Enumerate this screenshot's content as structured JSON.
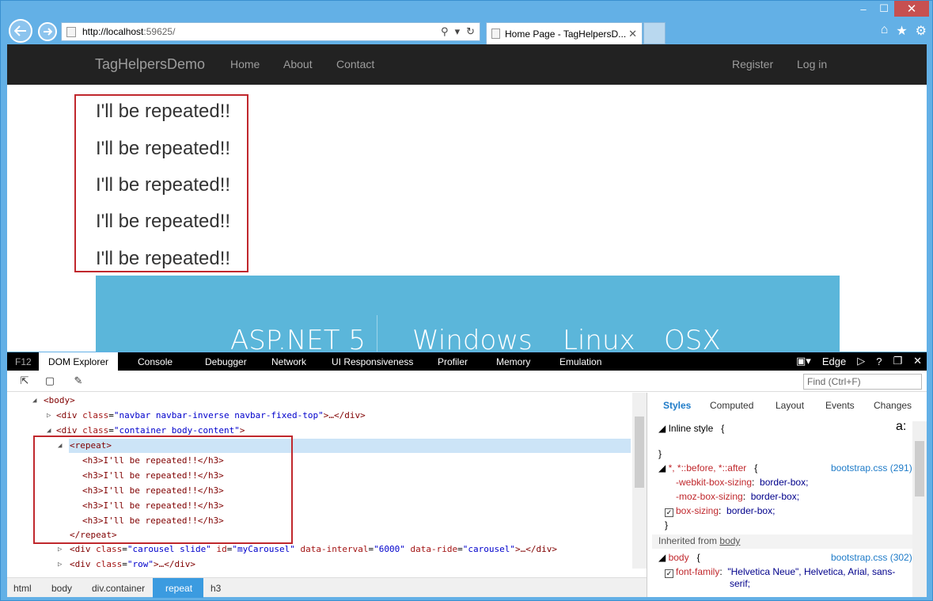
{
  "browser": {
    "address": {
      "host": "http://localhost",
      "rest": ":59625/"
    },
    "tab_title": "Home Page - TagHelpersD...",
    "window_buttons": [
      "–",
      "☐",
      "✕"
    ],
    "icons": [
      "home-icon",
      "star-icon",
      "gear-icon"
    ]
  },
  "site": {
    "brand": "TagHelpersDemo",
    "nav": [
      "Home",
      "About",
      "Contact"
    ],
    "nav_right": [
      "Register",
      "Log in"
    ],
    "repeated": [
      "I'll be repeated!!",
      "I'll be repeated!!",
      "I'll be repeated!!",
      "I'll be repeated!!",
      "I'll be repeated!!"
    ],
    "banner": [
      "ASP.NET 5",
      "Windows",
      "Linux",
      "OSX"
    ]
  },
  "devtools": {
    "f12": "F12",
    "tabs": [
      "DOM Explorer",
      "Console",
      "Debugger",
      "Network",
      "UI Responsiveness",
      "Profiler",
      "Memory",
      "Emulation"
    ],
    "mode": "Edge",
    "find_placeholder": "Find (Ctrl+F)",
    "dom": {
      "body": "<body>",
      "navbar_open": "<div ",
      "navbar_attr": "class",
      "navbar_val": "\"navbar navbar-inverse navbar-fixed-top\"",
      "navbar_close": ">…</div>",
      "container_open": "<div ",
      "container_attr": "class",
      "container_val": "\"container body-content\"",
      "container_close": ">",
      "repeat_open": "<repeat>",
      "h3_lines": [
        "<h3>I'll be repeated!!</h3>",
        "<h3>I'll be repeated!!</h3>",
        "<h3>I'll be repeated!!</h3>",
        "<h3>I'll be repeated!!</h3>",
        "<h3>I'll be repeated!!</h3>"
      ],
      "repeat_close": "</repeat>",
      "carousel_open": "<div ",
      "carousel_a1": "class",
      "carousel_v1": "\"carousel slide\"",
      "carousel_a2": "id",
      "carousel_v2": "\"myCarousel\"",
      "carousel_a3": "data-interval",
      "carousel_v3": "\"6000\"",
      "carousel_a4": "data-ride",
      "carousel_v4": "\"carousel\"",
      "carousel_close": ">…</div>",
      "row_open": "<div ",
      "row_attr": "class",
      "row_val": "\"row\"",
      "row_close": ">…</div>"
    },
    "breadcrumbs": [
      "html",
      "body",
      "div.container",
      "repeat",
      "h3"
    ],
    "styles_tabs": [
      "Styles",
      "Computed",
      "Layout",
      "Events",
      "Changes"
    ],
    "styles": {
      "inline": "Inline style",
      "inline_brace": "{",
      "close_brace": "}",
      "aa": "a:",
      "universal_selector": "*, *::before, *::after",
      "open_brace": "{",
      "universal_src": "bootstrap.css (291)",
      "p1": "-webkit-box-sizing",
      "v1": "border-box;",
      "p2": "-moz-box-sizing",
      "v2": "border-box;",
      "p3": "box-sizing",
      "v3": "border-box;",
      "inherited_label": "Inherited from",
      "inherited_from": "body",
      "body_selector": "body",
      "body_src": "bootstrap.css (302)",
      "p4": "font-family",
      "v4a": "\"Helvetica Neue\", Helvetica, Arial, sans-",
      "v4b": "serif;"
    }
  }
}
